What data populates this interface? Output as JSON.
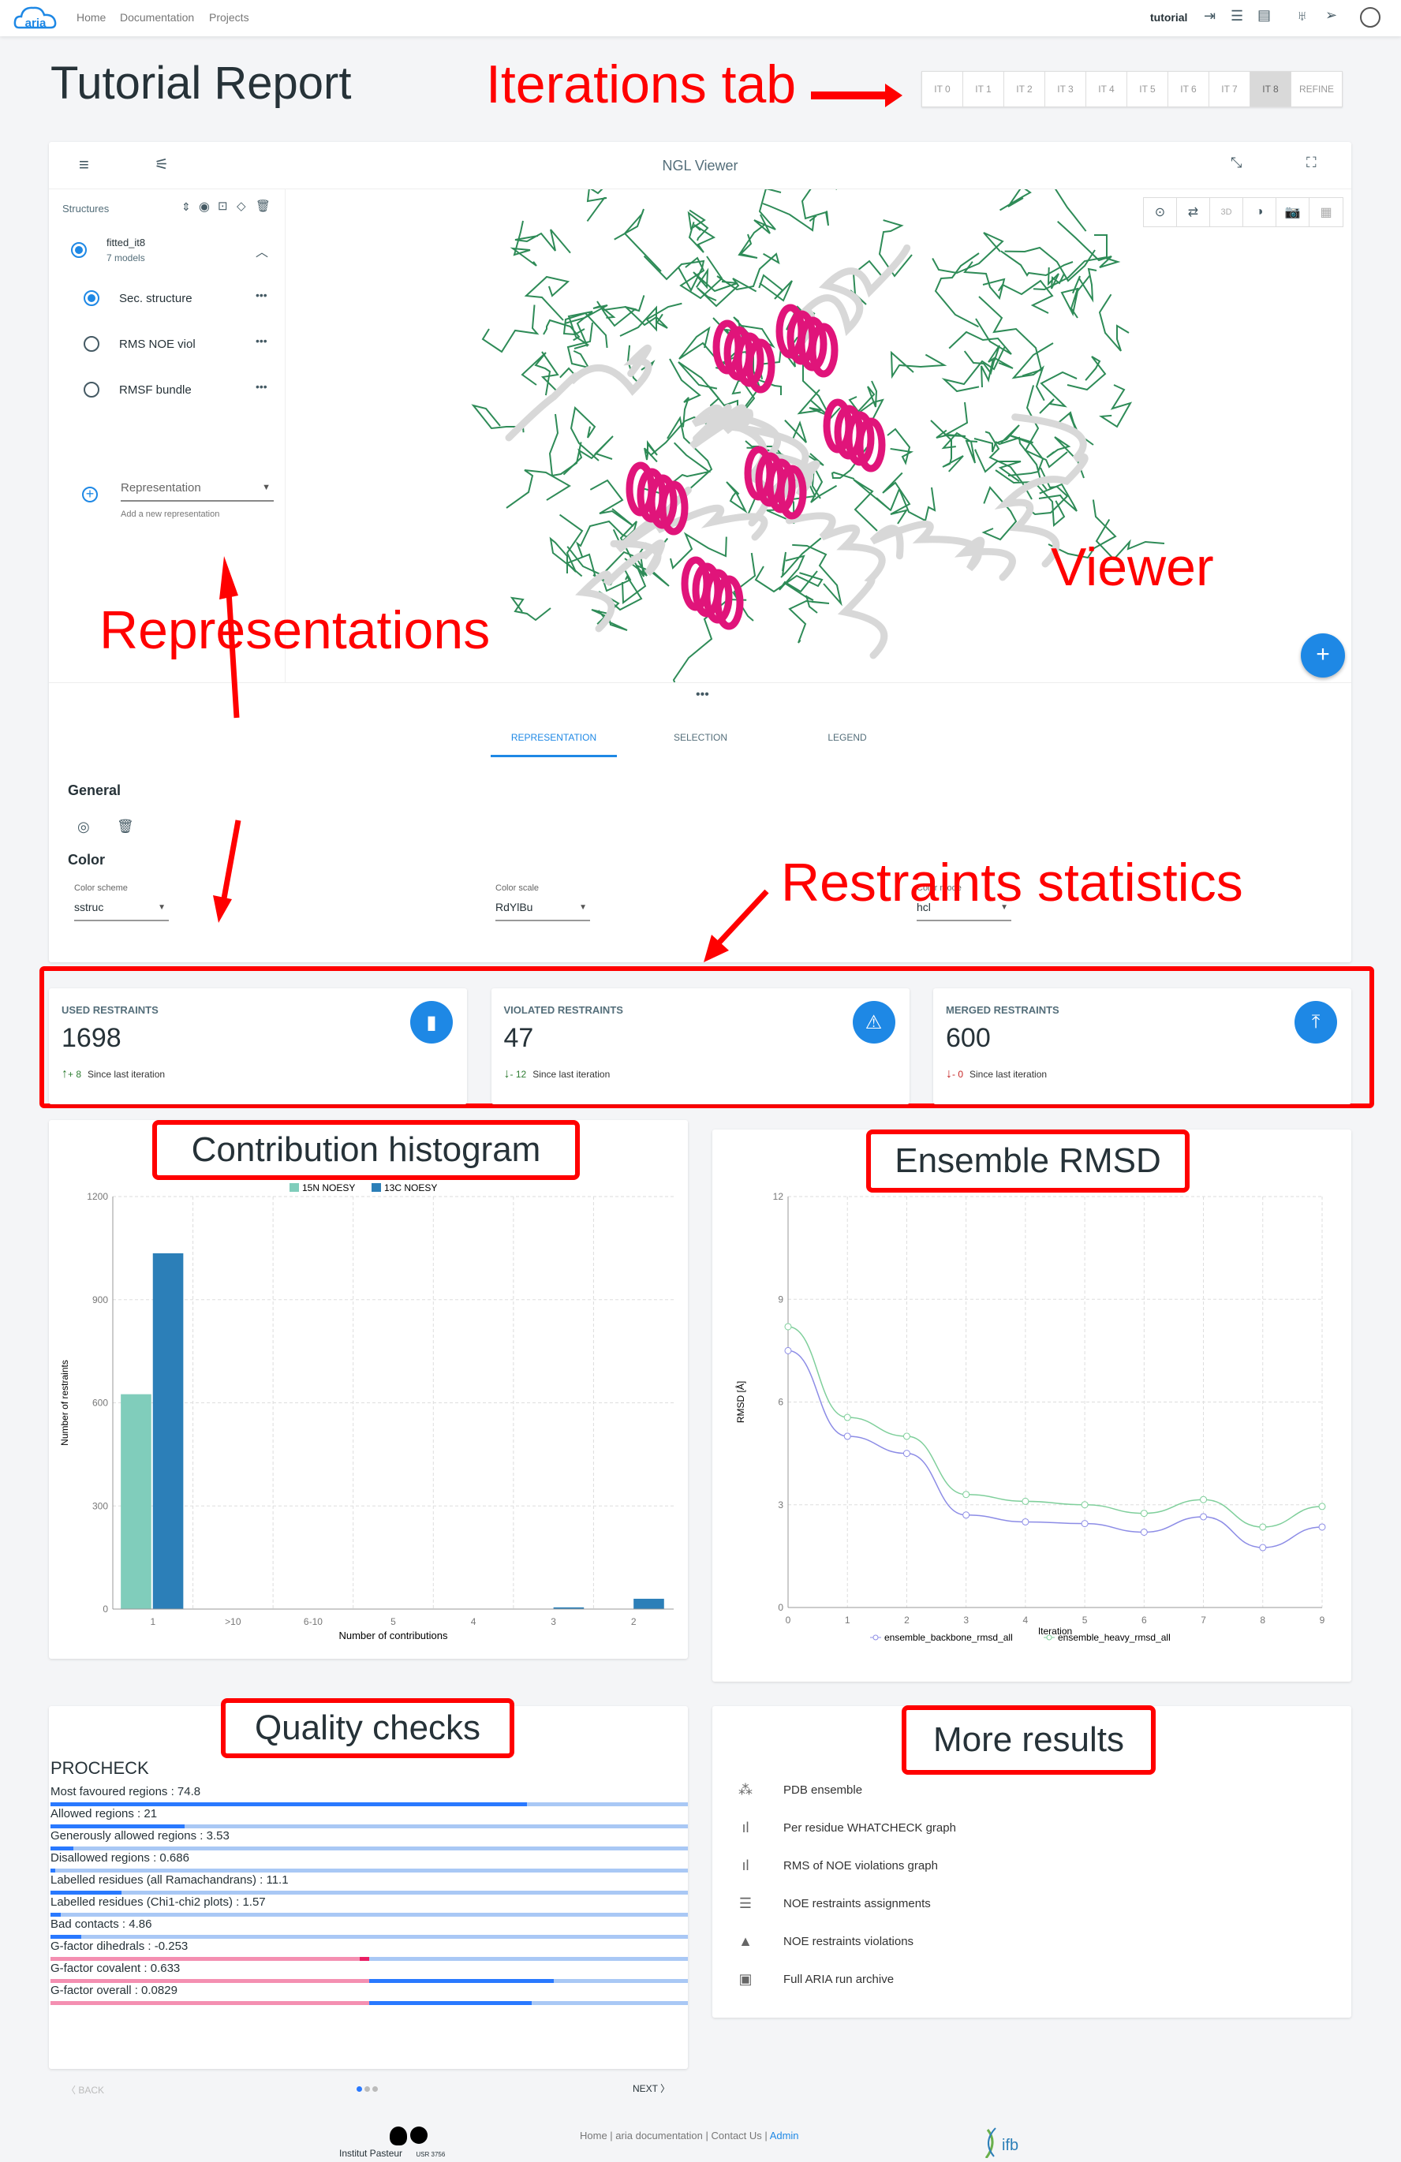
{
  "nav": {
    "links": [
      "Home",
      "Documentation",
      "Projects"
    ],
    "user": "tutorial"
  },
  "page": {
    "title": "Tutorial Report"
  },
  "iterations": {
    "tabs": [
      "IT 0",
      "IT 1",
      "IT 2",
      "IT 3",
      "IT 4",
      "IT 5",
      "IT 6",
      "IT 7",
      "IT 8",
      "REFINE"
    ],
    "active": "IT 8"
  },
  "annotations": {
    "iterations": "Iterations tab",
    "representations": "Representations",
    "viewer": "Viewer",
    "restraints": "Restraints statistics",
    "histogram": "Contribution histogram",
    "rmsd": "Ensemble RMSD",
    "quality": "Quality checks",
    "more": "More results"
  },
  "viewer": {
    "title": "NGL Viewer",
    "structures_label": "Structures",
    "structure": {
      "name": "fitted_it8",
      "models": "7 models"
    },
    "representations": [
      {
        "label": "Sec. structure",
        "selected": true
      },
      {
        "label": "RMS NOE viol",
        "selected": false
      },
      {
        "label": "RMSF bundle",
        "selected": false
      }
    ],
    "add_placeholder": "Representation",
    "add_hint": "Add a new representation",
    "tabs": [
      "REPRESENTATION",
      "SELECTION",
      "LEGEND"
    ],
    "active_tab": "REPRESENTATION",
    "general": "General",
    "color": "Color",
    "fields": [
      {
        "label": "Color scheme",
        "value": "sstruc"
      },
      {
        "label": "Color scale",
        "value": "RdYlBu"
      },
      {
        "label": "Color mode",
        "value": "hcl"
      }
    ]
  },
  "stats": [
    {
      "label": "USED RESTRAINTS",
      "value": "1698",
      "delta": "+ 8",
      "direction": "up",
      "delta_color": "#2e7d32",
      "since": "Since last iteration",
      "icon": "bar-chart-icon"
    },
    {
      "label": "VIOLATED RESTRAINTS",
      "value": "47",
      "delta": "- 12",
      "direction": "down",
      "delta_color": "#2e7d32",
      "since": "Since last iteration",
      "icon": "warning-icon"
    },
    {
      "label": "MERGED RESTRAINTS",
      "value": "600",
      "delta": "- 0",
      "direction": "down",
      "delta_color": "#c62828",
      "since": "Since last iteration",
      "icon": "merge-icon"
    }
  ],
  "chart_data": [
    {
      "type": "bar",
      "categories": [
        "1",
        ">10",
        "6-10",
        "5",
        "4",
        "3",
        "2"
      ],
      "series": [
        {
          "name": "15N NOESY",
          "color": "#80cdbb",
          "values": [
            625,
            0,
            0,
            0,
            0,
            0,
            1
          ]
        },
        {
          "name": "13C NOESY",
          "color": "#2c7fb8",
          "values": [
            1035,
            0,
            0,
            0,
            0,
            5,
            30
          ]
        }
      ],
      "xlabel": "Number of contributions",
      "ylabel": "Number of restraints",
      "ylim": [
        0,
        1200
      ],
      "yticks": [
        0,
        300,
        600,
        900,
        1200
      ],
      "grid": true,
      "legend": "top"
    },
    {
      "type": "line",
      "x": [
        0,
        1,
        2,
        3,
        4,
        5,
        6,
        7,
        8,
        9
      ],
      "series": [
        {
          "name": "ensemble_backbone_rmsd_all",
          "color": "#8c8ce6",
          "values": [
            7.5,
            5.0,
            4.5,
            2.7,
            2.5,
            2.45,
            2.2,
            2.65,
            1.75,
            2.35
          ]
        },
        {
          "name": "ensemble_heavy_rmsd_all",
          "color": "#7fcf9b",
          "values": [
            8.2,
            5.55,
            5.0,
            3.3,
            3.1,
            3.0,
            2.75,
            3.15,
            2.35,
            2.95
          ]
        }
      ],
      "xlabel": "Iteration",
      "ylabel": "RMSD [Å]",
      "ylim": [
        0,
        12
      ],
      "yticks": [
        0,
        3,
        6,
        9,
        12
      ],
      "xlim": [
        0,
        9
      ],
      "grid": true,
      "legend": "bottom"
    }
  ],
  "quality": {
    "title": "PROCHECK",
    "rows": [
      {
        "label": "Most favoured regions : 74.8",
        "fill": 0.748
      },
      {
        "label": "Allowed regions : 21",
        "fill": 0.21
      },
      {
        "label": "Generously allowed regions : 3.53",
        "fill": 0.0353
      },
      {
        "label": "Disallowed regions : 0.686",
        "fill": 0.00686
      },
      {
        "label": "Labelled residues (all Ramachandrans) : 11.1",
        "fill": 0.111
      },
      {
        "label": "Labelled residues (Chi1-chi2 plots) : 1.57",
        "fill": 0.0157
      },
      {
        "label": "Bad contacts : 4.86",
        "fill": 0.0486
      },
      {
        "label": "G-factor dihedrals : -0.253",
        "gfactor": true,
        "neg": 0.015,
        "pos": 0
      },
      {
        "label": "G-factor covalent : 0.633",
        "gfactor": true,
        "neg": 0,
        "pos": 0.29
      },
      {
        "label": "G-factor overall : 0.0829",
        "gfactor": true,
        "neg": 0,
        "pos": 0.255
      }
    ],
    "back": "BACK",
    "next": "NEXT",
    "pages": 3,
    "page": 1
  },
  "more": [
    {
      "icon": "scatter-icon",
      "label": "PDB ensemble"
    },
    {
      "icon": "bar-chart-icon",
      "label": "Per residue WHATCHECK graph"
    },
    {
      "icon": "bar-chart-icon",
      "label": "RMS of NOE violations graph"
    },
    {
      "icon": "numbered-list-icon",
      "label": "NOE restraints assignments"
    },
    {
      "icon": "warning-icon",
      "label": "NOE restraints violations"
    },
    {
      "icon": "archive-icon",
      "label": "Full ARIA run archive"
    }
  ],
  "footer": {
    "links": [
      "Home",
      "aria documentation",
      "Contact Us"
    ],
    "admin": "Admin",
    "logos": [
      "Institut Pasteur",
      "USR 3756",
      "ifb"
    ]
  },
  "colors": {
    "accent": "#1e88e5",
    "annotation": "#ff0000"
  }
}
